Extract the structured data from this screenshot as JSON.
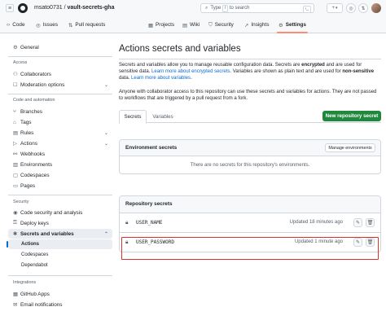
{
  "header": {
    "owner": "msato0731",
    "separator": "/",
    "repo": "vault-secrets-gha",
    "search_placeholder": "Type",
    "search_kbd": "/",
    "search_suffix": "to search",
    "plus_label": "+",
    "chevron": "▾"
  },
  "tabs": [
    {
      "label": "Code",
      "icon": "‹›"
    },
    {
      "label": "Issues",
      "icon": "◎"
    },
    {
      "label": "Pull requests",
      "icon": "⇅"
    },
    {
      "label": "Projects",
      "icon": "▦"
    },
    {
      "label": "Wiki",
      "icon": "▤"
    },
    {
      "label": "Security",
      "icon": "⛉"
    },
    {
      "label": "Insights",
      "icon": "↗"
    },
    {
      "label": "Settings",
      "icon": "⚙"
    }
  ],
  "sidebar": {
    "general": "General",
    "access_head": "Access",
    "collaborators": "Collaborators",
    "moderation": "Moderation options",
    "code_head": "Code and automation",
    "branches": "Branches",
    "tags": "Tags",
    "rules": "Rules",
    "actions": "Actions",
    "webhooks": "Webhooks",
    "environments": "Environments",
    "codespaces": "Codespaces",
    "pages": "Pages",
    "security_head": "Security",
    "code_security": "Code security and analysis",
    "deploy_keys": "Deploy keys",
    "secrets": "Secrets and variables",
    "sub_actions": "Actions",
    "sub_codespaces": "Codespaces",
    "sub_dependabot": "Dependabot",
    "integrations_head": "Integrations",
    "github_apps": "GitHub Apps",
    "email": "Email notifications"
  },
  "main": {
    "title": "Actions secrets and variables",
    "para1_a": "Secrets and variables allow you to manage reusable configuration data. Secrets are ",
    "para1_b": "encrypted",
    "para1_c": " and are used for sensitive data. ",
    "para1_link1": "Learn more about encrypted secrets",
    "para1_d": ". Variables are shown as plain text and are used for ",
    "para1_e": "non-sensitive",
    "para1_f": " data. ",
    "para1_link2": "Learn more about variables",
    "para1_g": ".",
    "para2": "Anyone with collaborator access to this repository can use these secrets and variables for actions. They are not passed to workflows that are triggered by a pull request from a fork.",
    "tab_secrets": "Secrets",
    "tab_variables": "Variables",
    "new_secret": "New repository secret",
    "env_title": "Environment secrets",
    "manage_env": "Manage environments",
    "env_empty": "There are no secrets for this repository's environments.",
    "repo_title": "Repository secrets",
    "secrets": [
      {
        "name": "USER_NAME",
        "updated": "Updated 18 minutes ago"
      },
      {
        "name": "USER_PASSWORD",
        "updated": "Updated 1 minute ago"
      }
    ]
  },
  "colors": {
    "accent": "#0969da",
    "primary_button": "#1f883d",
    "highlight": "#e0302a",
    "tab_underline": "#fd8c73"
  }
}
